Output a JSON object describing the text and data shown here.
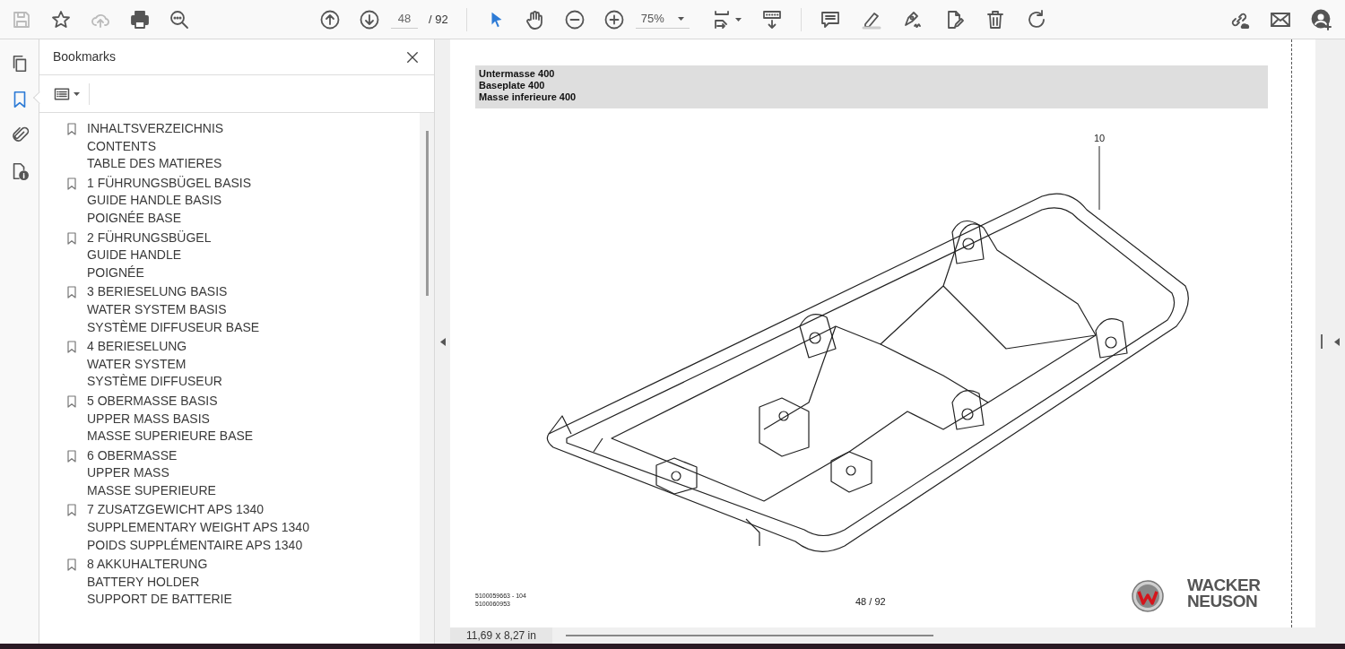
{
  "toolbar": {
    "page_number": "48",
    "page_total": "/ 92",
    "zoom": "75%"
  },
  "side_rail": [
    {
      "kind": "pages",
      "selected": false
    },
    {
      "kind": "bookmarks",
      "selected": true
    },
    {
      "kind": "attachments",
      "selected": false
    },
    {
      "kind": "info",
      "selected": false
    }
  ],
  "bookmarks_panel": {
    "title": "Bookmarks",
    "items": [
      {
        "lines": [
          "INHALTSVERZEICHNIS",
          "CONTENTS",
          "TABLE DES MATIERES"
        ]
      },
      {
        "lines": [
          "1 FÜHRUNGSBÜGEL BASIS",
          "GUIDE HANDLE BASIS",
          "POIGNÉE BASE"
        ]
      },
      {
        "lines": [
          "2 FÜHRUNGSBÜGEL",
          "GUIDE HANDLE",
          "POIGNÉE"
        ]
      },
      {
        "lines": [
          "3 BERIESELUNG BASIS",
          "WATER SYSTEM BASIS",
          "SYSTÈME DIFFUSEUR BASE"
        ]
      },
      {
        "lines": [
          "4 BERIESELUNG",
          "WATER SYSTEM",
          "SYSTÈME DIFFUSEUR"
        ]
      },
      {
        "lines": [
          "5 OBERMASSE BASIS",
          "UPPER MASS BASIS",
          "MASSE SUPERIEURE BASE"
        ]
      },
      {
        "lines": [
          "6 OBERMASSE",
          "UPPER MASS",
          "MASSE SUPERIEURE"
        ]
      },
      {
        "lines": [
          "7 ZUSATZGEWICHT APS 1340",
          "SUPPLEMENTARY WEIGHT APS 1340",
          "POIDS SUPPLÉMENTAIRE APS 1340"
        ]
      },
      {
        "lines": [
          "8 AKKUHALTERUNG",
          "BATTERY HOLDER",
          "SUPPORT DE BATTERIE"
        ]
      }
    ]
  },
  "document": {
    "header_lines": [
      "Untermasse 400",
      "Baseplate 400",
      "Masse inferieure 400"
    ],
    "callout": "10",
    "doc_numbers": [
      "5100059663 - 104",
      "5100060953"
    ],
    "page_label": "48 / 92",
    "brand_lines": [
      "WACKER",
      "NEUSON"
    ]
  },
  "status_bar": {
    "page_size": "11,69 x 8,27 in"
  }
}
